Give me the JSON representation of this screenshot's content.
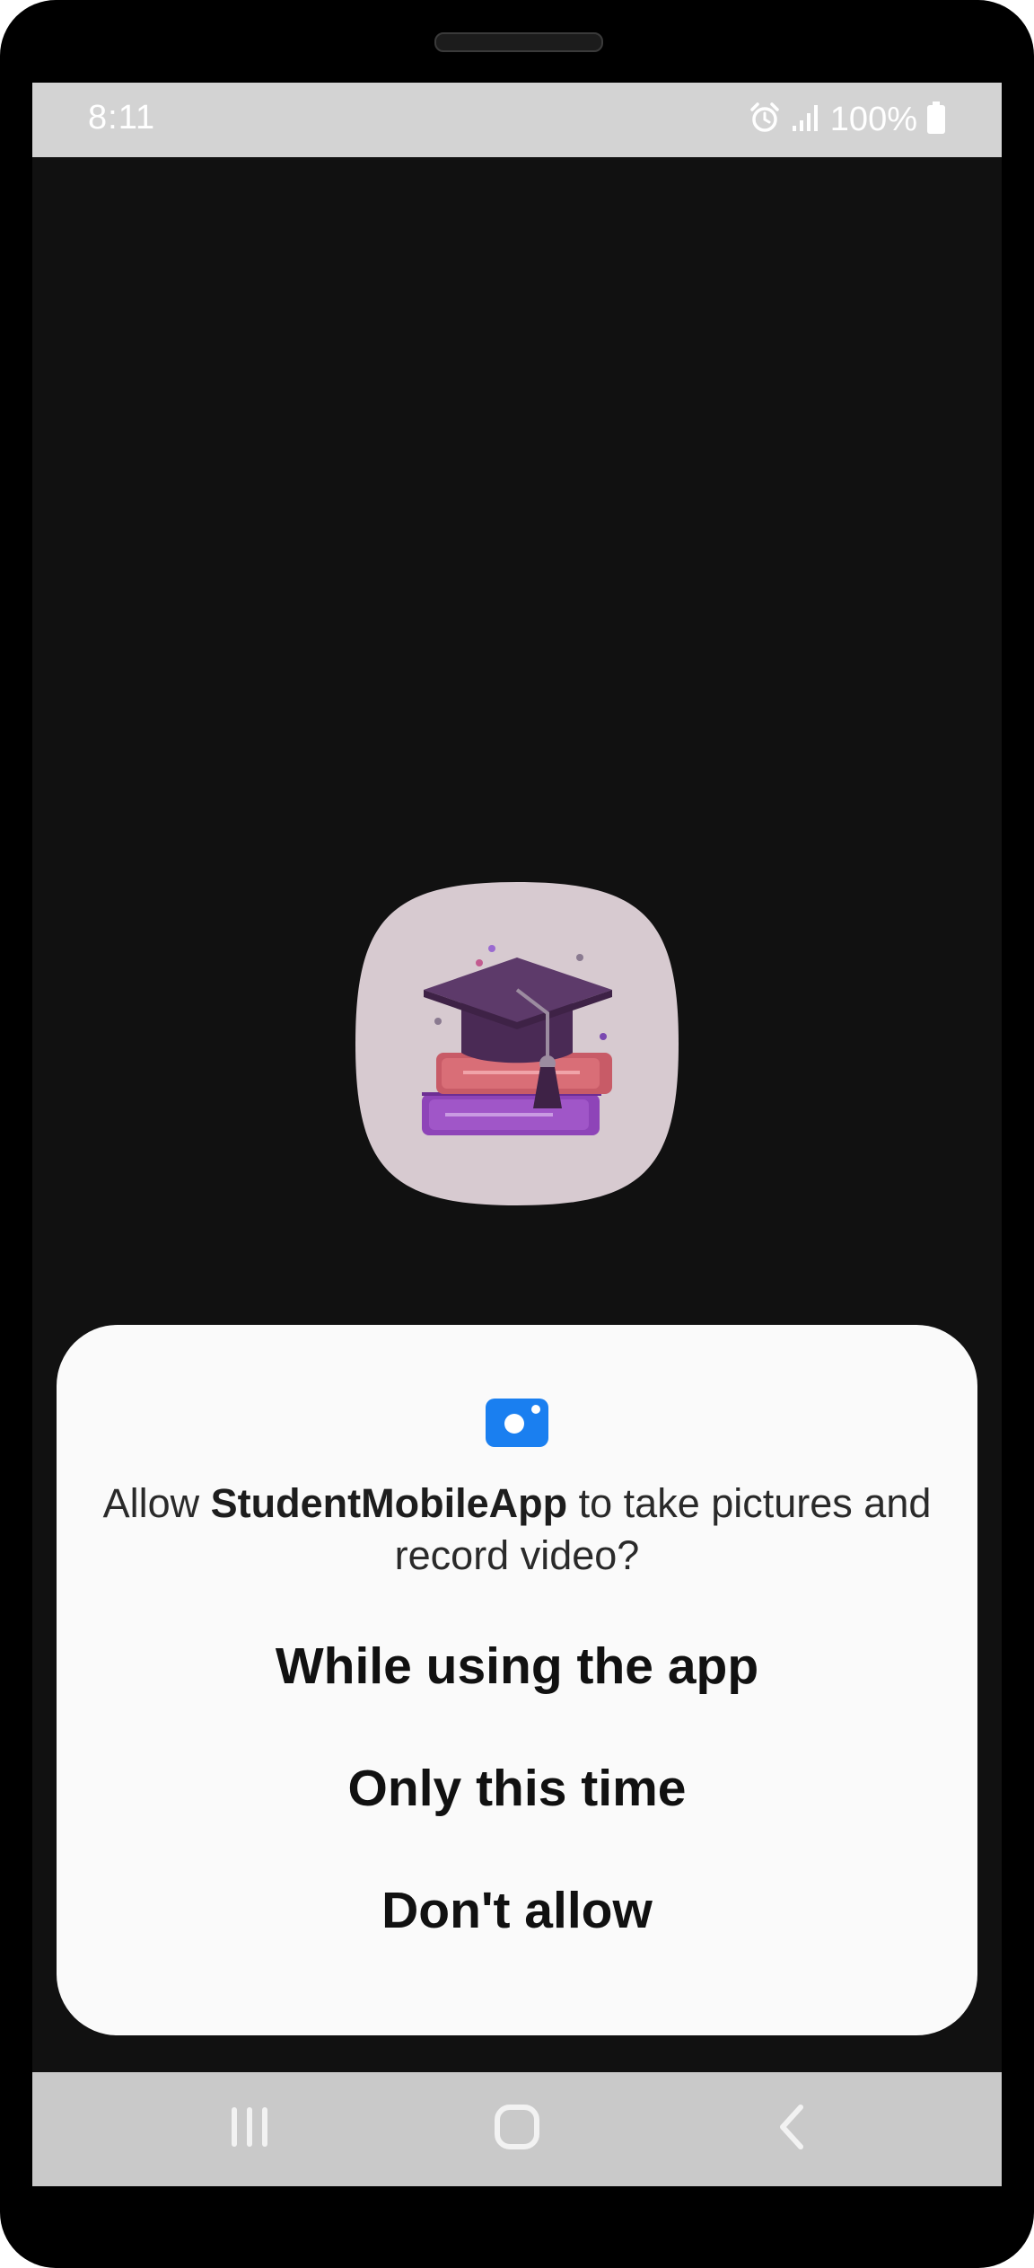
{
  "status_bar": {
    "time": "8:11",
    "battery": "100%",
    "icons": [
      "alarm-icon",
      "signal-icon",
      "battery-icon"
    ]
  },
  "app": {
    "logo_icon": "graduation-cap-books-icon"
  },
  "permission_dialog": {
    "icon": "camera-icon",
    "accent_color": "#1a7ff0",
    "message_prefix": "Allow ",
    "app_name": "StudentMobileApp",
    "message_suffix": " to take pictures and record video?",
    "options": [
      {
        "label": "While using the app"
      },
      {
        "label": "Only this time"
      },
      {
        "label": "Don't allow"
      }
    ]
  },
  "nav_bar": {
    "buttons": [
      "recents-icon",
      "home-icon",
      "back-icon"
    ]
  }
}
